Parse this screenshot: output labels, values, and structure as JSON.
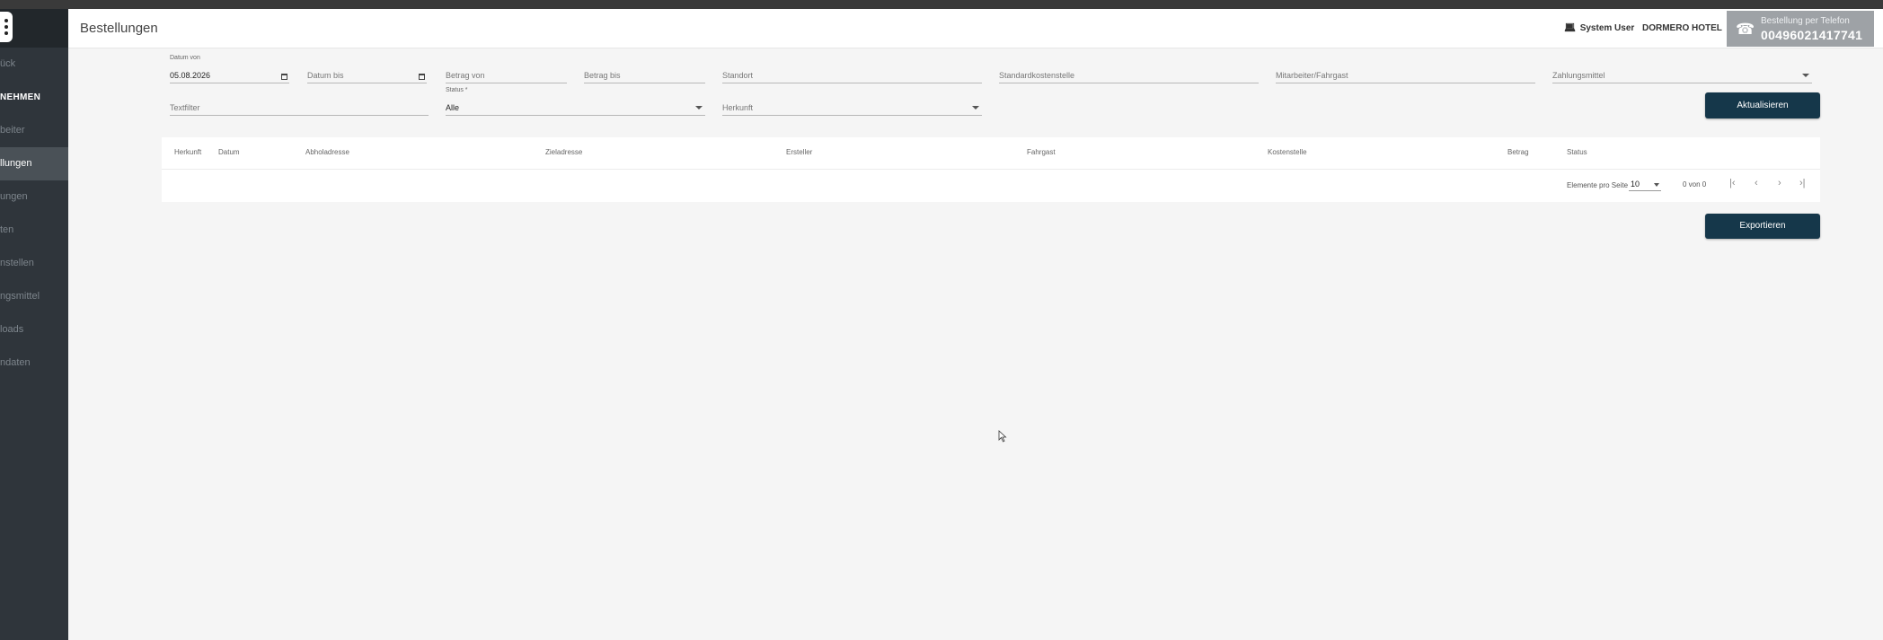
{
  "header": {
    "title": "Bestellungen",
    "user": "System User",
    "hotel": "DORMERO HOTEL",
    "phone_label": "Bestellung per Telefon",
    "phone_number": "00496021417741"
  },
  "sidebar": {
    "items": [
      {
        "label": "ück"
      },
      {
        "label": "NEHMEN"
      },
      {
        "label": "beiter"
      },
      {
        "label": "llungen"
      },
      {
        "label": "ungen"
      },
      {
        "label": "ten"
      },
      {
        "label": "nstellen"
      },
      {
        "label": "ngsmittel"
      },
      {
        "label": "loads"
      },
      {
        "label": "ndaten"
      }
    ]
  },
  "filters": {
    "datum_von_label": "Datum von",
    "datum_von_value": "05.08.2026",
    "datum_bis": "Datum bis",
    "betrag_von": "Betrag von",
    "betrag_bis": "Betrag bis",
    "standort": "Standort",
    "standardkostenstelle": "Standardkostenstelle",
    "mitarbeiter": "Mitarbeiter/Fahrgast",
    "zahlungsmittel": "Zahlungsmittel",
    "textfilter": "Textfilter",
    "status_label": "Status *",
    "status_value": "Alle",
    "herkunft": "Herkunft"
  },
  "buttons": {
    "refresh": "Aktualisieren",
    "export": "Exportieren"
  },
  "table": {
    "columns": [
      "Herkunft",
      "Datum",
      "Abholadresse",
      "Zieladresse",
      "Ersteller",
      "Fahrgast",
      "Kostenstelle",
      "Betrag",
      "Status"
    ]
  },
  "pagination": {
    "per_page_label": "Elemente pro Seite",
    "per_page_value": "10",
    "range": "0 von 0"
  }
}
